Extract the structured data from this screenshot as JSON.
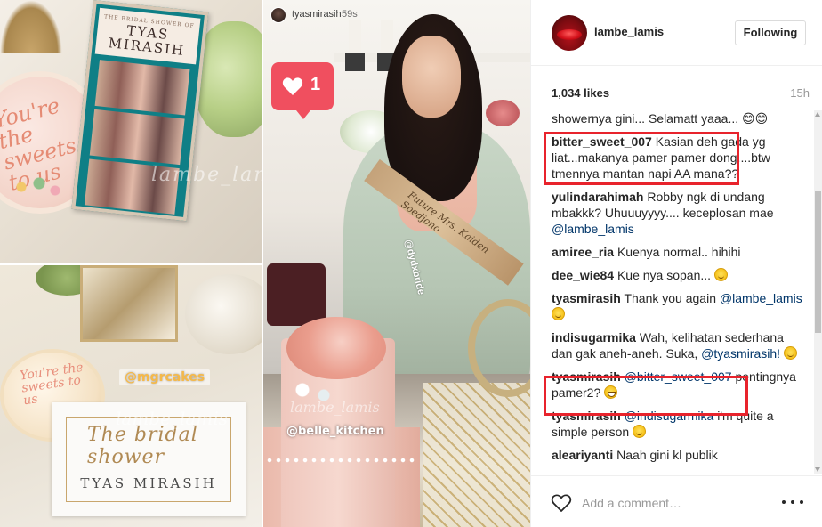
{
  "collage": {
    "booth_subtitle": "THE BRIDAL SHOWER OF",
    "booth_title": "TYAS MIRASIH",
    "cookie_big_text": "You're the sweets to us",
    "cookie_small_text": "You're the sweets to us",
    "card_script": "The bridal shower",
    "card_name": "TYAS MIRASIH",
    "watermark": "lambe_lamis",
    "tag_mgrcakes": "@mgrcakes",
    "story_user": "tyasmirasih",
    "story_time": "59s",
    "like_count": "1",
    "sash_text": "Future Mrs. Kaiden Soedjono",
    "tag_dydxbride": "@dydxbride",
    "tag_belle": "@belle_kitchen"
  },
  "sidebar": {
    "username": "lambe_lamis",
    "follow_label": "Following",
    "likes": "1,034 likes",
    "time_ago": "15h",
    "add_comment_placeholder": "Add a comment…"
  },
  "comments": [
    {
      "user": "",
      "text": "showernya gini... Selamatt yaaa... 😊😊"
    },
    {
      "user": "bitter_sweet_007",
      "text": "Kasian deh gada yg liat...makanya pamer pamer dong....btw tmennya mantan napi AA mana??"
    },
    {
      "user": "yulindarahimah",
      "text": "Robby ngk di undang mbakkk? Uhuuuyyyy.... keceplosan mae",
      "mention": "@lambe_lamis"
    },
    {
      "user": "amiree_ria",
      "text": "Kuenya normal.. hihihi"
    },
    {
      "user": "dee_wie84",
      "text": "Kue nya sopan..."
    },
    {
      "user": "tyasmirasih",
      "text": "Thank you again",
      "mention": "@lambe_lamis"
    },
    {
      "user": "indisugarmika",
      "text": "Wah, kelihatan sederhana dan gak aneh-aneh. Suka,",
      "mention": "@tyasmirasih!"
    },
    {
      "user": "tyasmirasih",
      "mention_first": "@bitter_sweet_007",
      "text": "pentingnya pamer2?"
    },
    {
      "user": "tyasmirasih",
      "mention_first": "@indisugarmika",
      "text": "i'm quite a simple person"
    },
    {
      "user": "aleariyanti",
      "text": "Naah gini kl publik"
    }
  ],
  "colors": {
    "highlight": "#e8232c",
    "like_bubble": "#f04f5f",
    "mention": "#003569"
  },
  "icons": {
    "heart": "heart-icon",
    "more": "more-options-icon",
    "emoji": "smiley-emoji-icon"
  }
}
